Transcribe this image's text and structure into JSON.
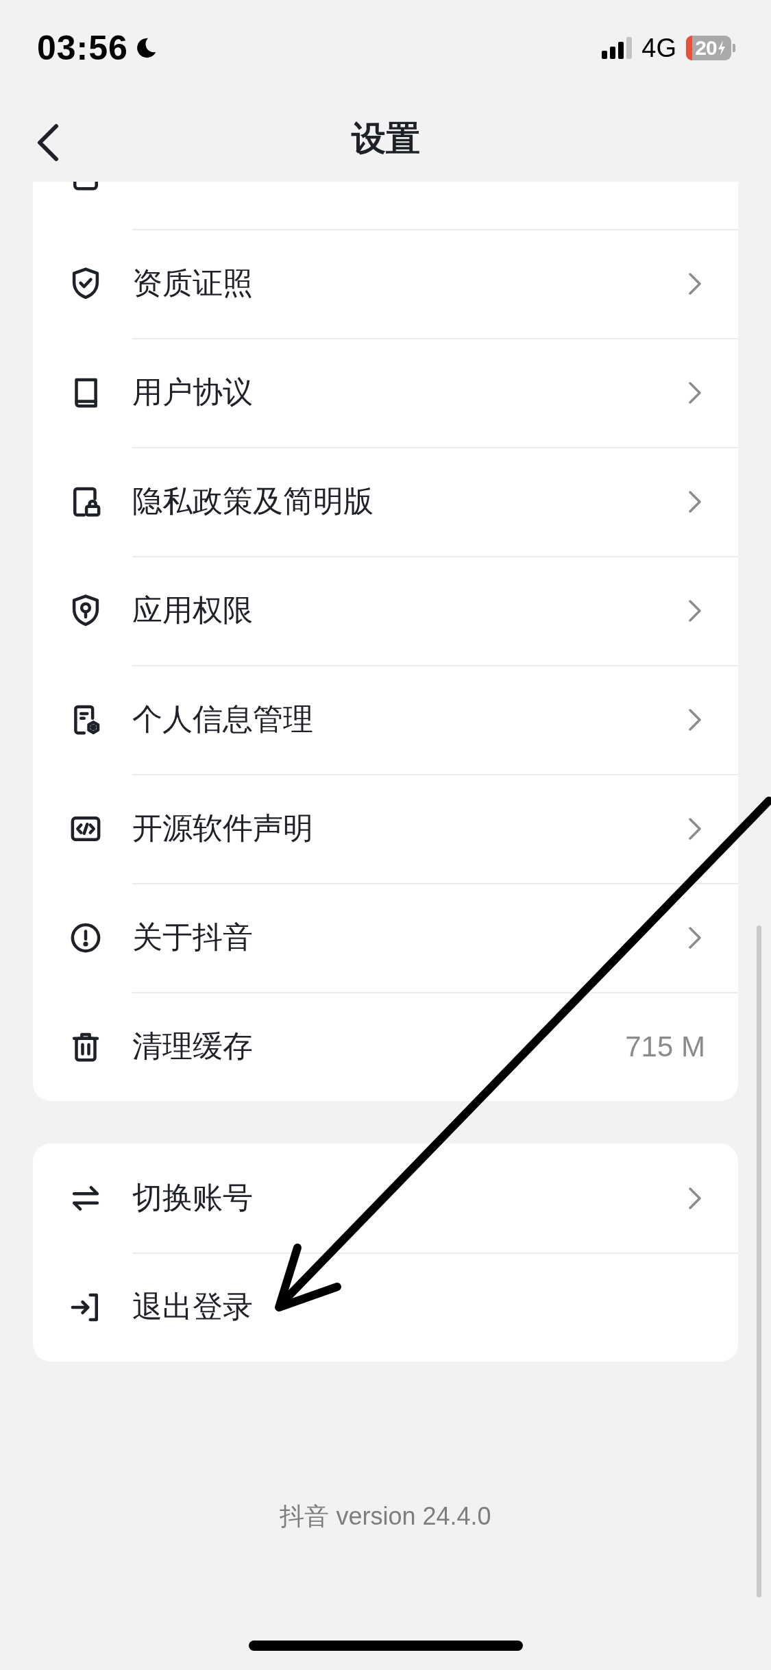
{
  "status_bar": {
    "time": "03:56",
    "network": "4G",
    "battery": "20"
  },
  "header": {
    "title": "设置"
  },
  "sections": [
    {
      "rows": [
        {
          "kind": "partial"
        },
        {
          "label": "资质证照",
          "kind": "link"
        },
        {
          "label": "用户协议",
          "kind": "link"
        },
        {
          "label": "隐私政策及简明版",
          "kind": "link"
        },
        {
          "label": "应用权限",
          "kind": "link"
        },
        {
          "label": "个人信息管理",
          "kind": "link"
        },
        {
          "label": "开源软件声明",
          "kind": "link"
        },
        {
          "label": "关于抖音",
          "kind": "link"
        },
        {
          "label": "清理缓存",
          "kind": "value",
          "value": "715 M"
        }
      ]
    },
    {
      "rows": [
        {
          "label": "切换账号",
          "kind": "link"
        },
        {
          "label": "退出登录",
          "kind": "action"
        }
      ]
    }
  ],
  "footer": {
    "version": "抖音 version 24.4.0"
  },
  "annotation": {
    "kind": "arrow"
  }
}
